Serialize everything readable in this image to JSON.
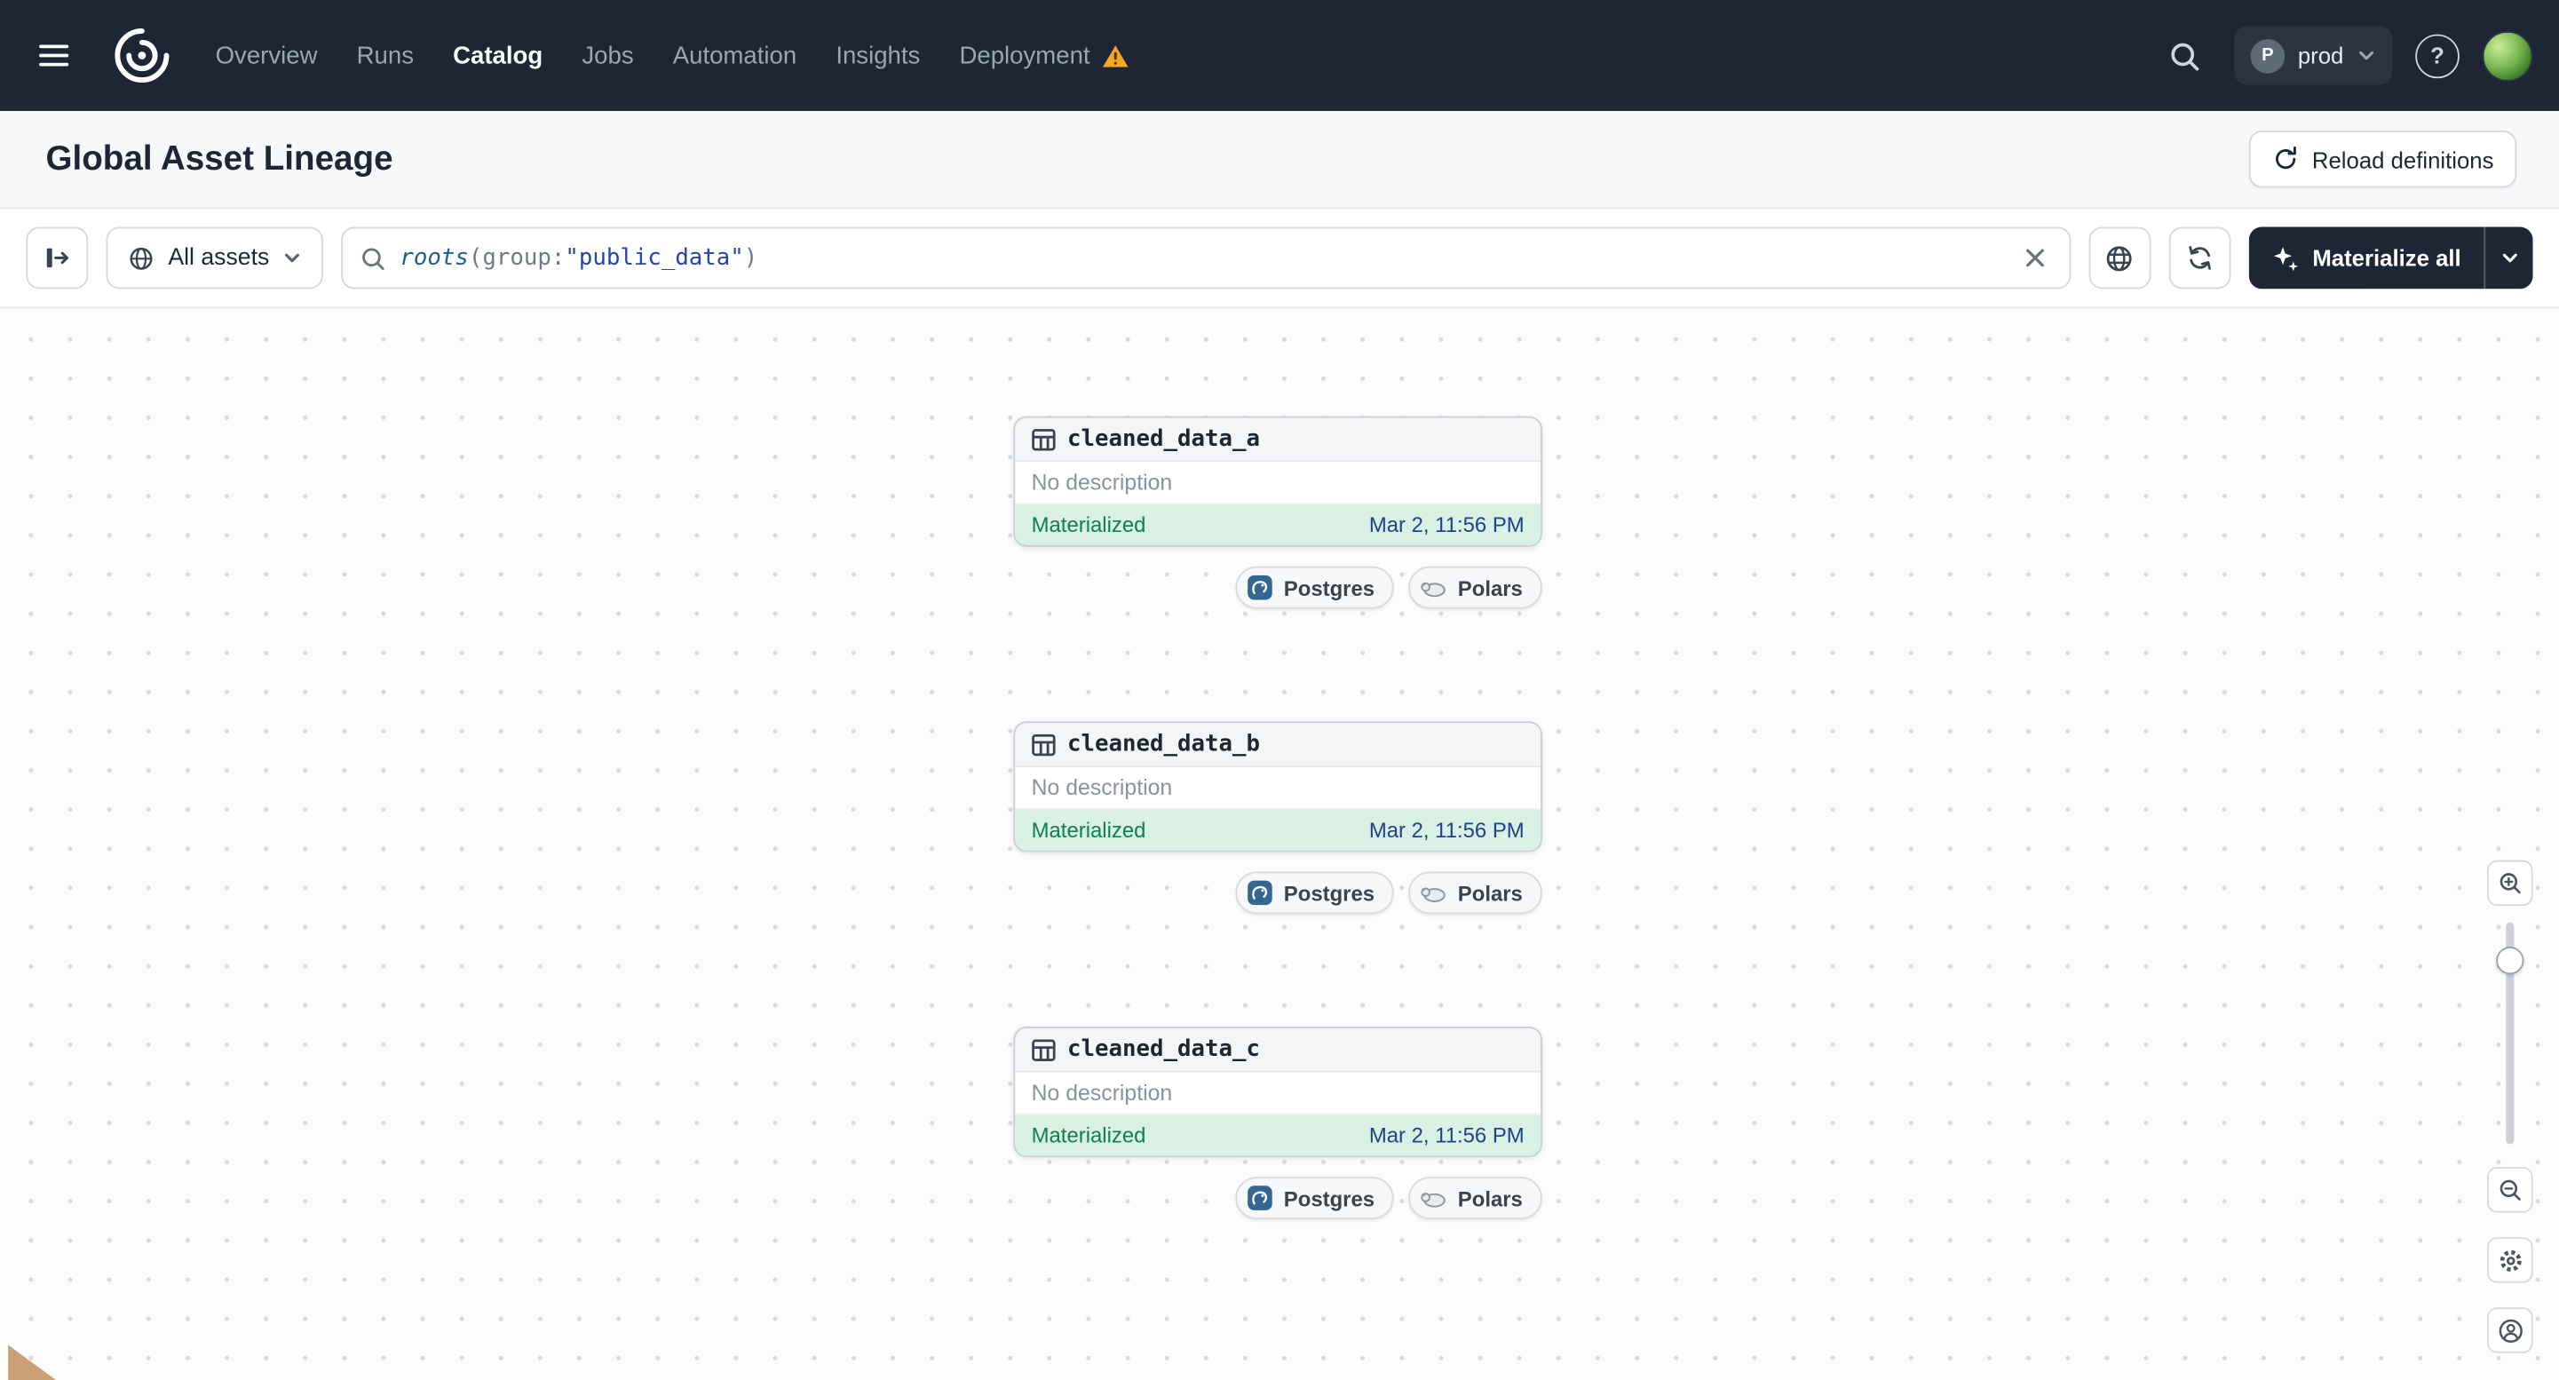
{
  "nav": {
    "items": [
      {
        "label": "Overview",
        "active": false
      },
      {
        "label": "Runs",
        "active": false
      },
      {
        "label": "Catalog",
        "active": true
      },
      {
        "label": "Jobs",
        "active": false
      },
      {
        "label": "Automation",
        "active": false
      },
      {
        "label": "Insights",
        "active": false
      },
      {
        "label": "Deployment",
        "active": false,
        "warning": true
      }
    ],
    "deployment_switcher": {
      "initial": "P",
      "label": "prod"
    }
  },
  "page_header": {
    "title": "Global Asset Lineage",
    "reload_button_label": "Reload definitions"
  },
  "toolbar": {
    "scope_filter_label": "All assets",
    "search": {
      "query_function": "roots",
      "query_open": "(",
      "query_attr": "group:",
      "query_value": "\"public_data\"",
      "query_close": ")"
    },
    "materialize_button_label": "Materialize all"
  },
  "graph": {
    "nodes": [
      {
        "name": "cleaned_data_a",
        "description": "No description",
        "status": "Materialized",
        "timestamp": "Mar 2, 11:56 PM",
        "tags": [
          {
            "label": "Postgres"
          },
          {
            "label": "Polars"
          }
        ]
      },
      {
        "name": "cleaned_data_b",
        "description": "No description",
        "status": "Materialized",
        "timestamp": "Mar 2, 11:56 PM",
        "tags": [
          {
            "label": "Postgres"
          },
          {
            "label": "Polars"
          }
        ]
      },
      {
        "name": "cleaned_data_c",
        "description": "No description",
        "status": "Materialized",
        "timestamp": "Mar 2, 11:56 PM",
        "tags": [
          {
            "label": "Postgres"
          },
          {
            "label": "Polars"
          }
        ]
      }
    ]
  },
  "icons": {
    "help_glyph": "?",
    "names": [
      "menu-icon",
      "dagster-logo",
      "warning-icon",
      "search-icon",
      "chevron-down-icon",
      "help-icon",
      "avatar",
      "reload-icon",
      "panel-toggle-icon",
      "globe-icon",
      "clear-icon",
      "syntax-globe-icon",
      "refresh-icon",
      "sparkle-icon",
      "table-icon",
      "postgres-icon",
      "polars-icon",
      "zoom-in-icon",
      "zoom-out-icon",
      "gear-icon",
      "user-icon"
    ]
  },
  "colors": {
    "nav_bg": "#1c2634",
    "materialized_bg": "#d8f1e2",
    "materialized_text": "#0f8050",
    "timestamp_text": "#23408f",
    "warning": "#f5a623",
    "accent_dark": "#1c2634"
  }
}
